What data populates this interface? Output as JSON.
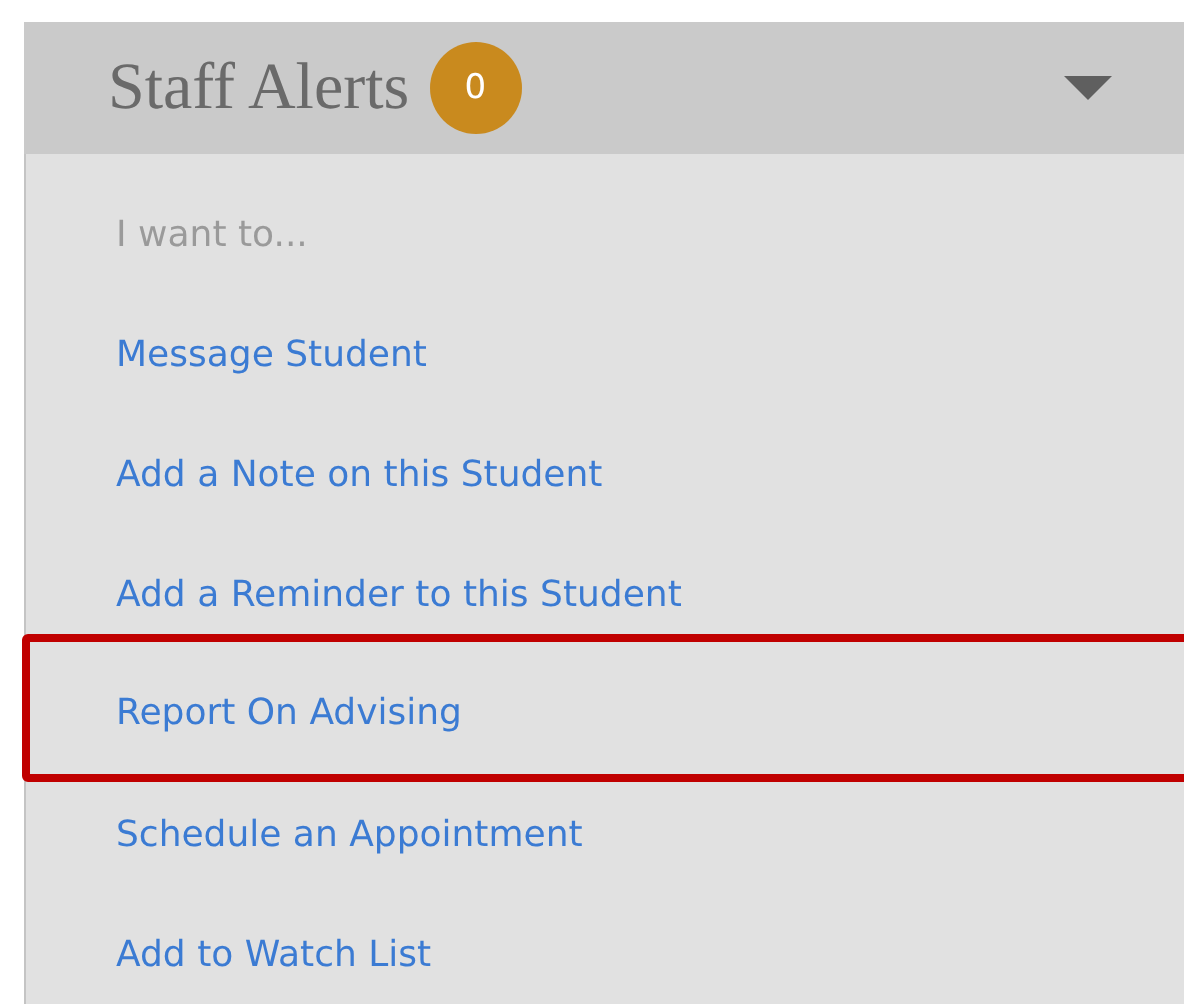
{
  "panel": {
    "title": "Staff Alerts",
    "badge": "0",
    "expanded": true,
    "heading": "I want to...",
    "items": [
      {
        "label": "Message Student",
        "highlighted": false
      },
      {
        "label": "Add a Note on this Student",
        "highlighted": false
      },
      {
        "label": "Add a Reminder to this Student",
        "highlighted": false
      },
      {
        "label": "Report On Advising",
        "highlighted": true
      },
      {
        "label": "Schedule an Appointment",
        "highlighted": false
      },
      {
        "label": "Add to Watch List",
        "highlighted": false
      }
    ]
  }
}
